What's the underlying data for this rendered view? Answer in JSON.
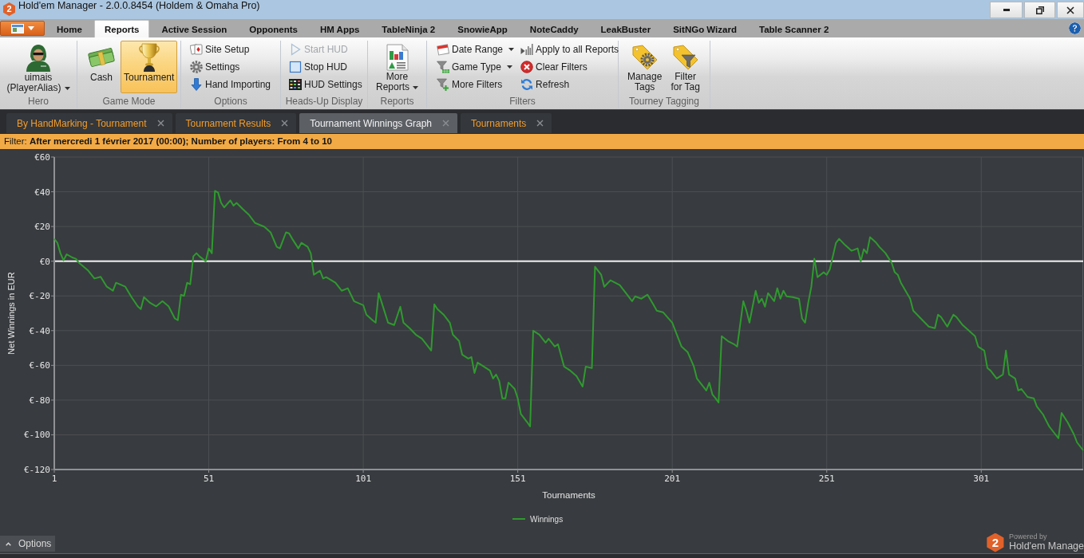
{
  "window": {
    "logo_text": "2",
    "title": "Hold'em Manager - 2.0.0.8454 (Holdem & Omaha Pro)"
  },
  "ribbon_tabs": [
    {
      "label": "Home",
      "selected": false
    },
    {
      "label": "Reports",
      "selected": true
    },
    {
      "label": "Active Session",
      "selected": false
    },
    {
      "label": "Opponents",
      "selected": false
    },
    {
      "label": "HM Apps",
      "selected": false
    },
    {
      "label": "TableNinja 2",
      "selected": false
    },
    {
      "label": "SnowieApp",
      "selected": false
    },
    {
      "label": "NoteCaddy",
      "selected": false
    },
    {
      "label": "LeakBuster",
      "selected": false
    },
    {
      "label": "SitNGo Wizard",
      "selected": false
    },
    {
      "label": "Table Scanner 2",
      "selected": false
    }
  ],
  "ribbon": {
    "hero": {
      "label": "uimais\n(PlayerAlias)",
      "dropdown": true,
      "group_label": "Hero"
    },
    "game_mode": {
      "buttons": [
        {
          "label": "Cash",
          "selected": false
        },
        {
          "label": "Tournament",
          "selected": true
        }
      ],
      "group_label": "Game Mode"
    },
    "options": {
      "items": [
        {
          "label": "Site Setup"
        },
        {
          "label": "Settings"
        },
        {
          "label": "Hand Importing"
        }
      ],
      "group_label": "Options"
    },
    "heads_up_display": {
      "items": [
        {
          "label": "Start HUD",
          "disabled": true
        },
        {
          "label": "Stop HUD",
          "disabled": false
        },
        {
          "label": "HUD Settings",
          "disabled": false
        }
      ],
      "group_label": "Heads-Up Display"
    },
    "reports": {
      "button": {
        "label": "More\nReports",
        "dropdown": true
      },
      "group_label": "Reports"
    },
    "filters": {
      "items": [
        {
          "label": "Date Range",
          "dropdown": true
        },
        {
          "label": "Game Type",
          "dropdown": true
        },
        {
          "label": "More Filters",
          "dropdown": false
        },
        {
          "label": "Apply to all Reports",
          "dropdown": false
        },
        {
          "label": "Clear Filters",
          "dropdown": false
        },
        {
          "label": "Refresh",
          "dropdown": false
        }
      ],
      "group_label": "Filters"
    },
    "tourney_tagging": {
      "buttons": [
        {
          "label": "Manage\nTags"
        },
        {
          "label": "Filter\nfor Tag"
        }
      ],
      "group_label": "Tourney Tagging"
    }
  },
  "document_tabs": [
    {
      "label": "By HandMarking - Tournament",
      "selected": false
    },
    {
      "label": "Tournament Results",
      "selected": false
    },
    {
      "label": "Tournament Winnings Graph",
      "selected": true
    },
    {
      "label": "Tournaments",
      "selected": false
    }
  ],
  "filter_bar": {
    "text": "Filter: **After mercredi 1 février 2017 (00:00); Number of players: From 4 to 10**"
  },
  "graph": {
    "chart_data": {
      "type": "line",
      "xlabel": "Tournaments",
      "ylabel": "Net Winnings in EUR",
      "xlim": [
        1,
        334
      ],
      "ylim": [
        -120,
        60
      ],
      "xticks": [
        1,
        51,
        101,
        151,
        201,
        251,
        301
      ],
      "yticks": [
        {
          "value": 60,
          "label": "€60"
        },
        {
          "value": 40,
          "label": "€40"
        },
        {
          "value": 20,
          "label": "€20"
        },
        {
          "value": 0,
          "label": "€0"
        },
        {
          "value": -20,
          "label": "€-20"
        },
        {
          "value": -40,
          "label": "€-40"
        },
        {
          "value": -60,
          "label": "€-60"
        },
        {
          "value": -80,
          "label": "€-80"
        },
        {
          "value": -100,
          "label": "€-100"
        },
        {
          "value": -120,
          "label": "€-120"
        }
      ],
      "x": [
        1,
        2,
        3,
        4,
        5,
        7,
        8,
        9,
        12,
        14,
        16,
        18,
        20,
        21,
        24,
        26,
        28,
        29,
        30,
        32,
        34,
        36,
        38,
        40,
        41,
        42,
        43,
        44,
        45,
        46,
        47,
        48,
        50,
        51,
        52,
        53,
        54,
        55,
        56,
        58,
        59,
        60,
        62,
        64,
        66,
        69,
        71,
        73,
        74,
        76,
        77,
        78,
        80,
        81,
        83,
        84,
        85,
        87,
        88,
        89,
        92,
        94,
        96,
        98,
        101,
        102,
        104,
        105,
        106,
        107,
        109,
        111,
        113,
        114,
        116,
        118,
        120,
        122,
        123,
        124,
        125,
        127,
        129,
        130,
        132,
        133,
        135,
        136,
        137,
        138,
        140,
        142,
        143,
        144,
        145,
        146,
        147,
        148,
        150,
        151,
        152,
        154,
        155,
        156,
        158,
        160,
        161,
        163,
        164,
        166,
        168,
        170,
        172,
        173,
        175,
        176,
        178,
        179,
        181,
        184,
        186,
        188,
        189,
        191,
        193,
        195,
        196,
        198,
        201,
        203,
        204,
        206,
        208,
        209,
        211,
        212,
        213,
        214,
        215,
        216,
        217,
        219,
        221,
        222,
        224,
        225,
        226,
        228,
        229,
        230,
        231,
        232,
        234,
        235,
        236,
        237,
        238,
        240,
        242,
        243,
        244,
        245,
        246,
        247,
        248,
        250,
        251,
        252,
        254,
        255,
        257,
        259,
        261,
        262,
        263,
        264,
        265,
        267,
        268,
        270,
        272,
        273,
        274,
        275,
        278,
        279,
        282,
        284,
        286,
        287,
        288,
        290,
        292,
        293,
        295,
        297,
        299,
        300,
        302,
        303,
        304,
        306,
        308,
        309,
        310,
        312,
        313,
        314,
        316,
        318,
        319,
        321,
        323,
        325,
        326,
        327,
        329,
        331,
        332,
        334
      ],
      "series": [
        {
          "name": "Winnings",
          "color": "#2f9a2f",
          "values": [
            12.9,
            10.6,
            4.6,
            0.5,
            4,
            2,
            1.4,
            -1,
            -5.5,
            -10,
            -9,
            -14.7,
            -17,
            -12.4,
            -14.7,
            -20.7,
            -26,
            -27.6,
            -20.7,
            -24,
            -26,
            -23,
            -26,
            -33,
            -34,
            -19.3,
            -20,
            -12.4,
            -13.3,
            2.8,
            4.6,
            2.8,
            0,
            7.4,
            4.6,
            40.5,
            39.5,
            33.6,
            31,
            35,
            32,
            33.6,
            30,
            26.7,
            22,
            19.8,
            16.6,
            8.3,
            7.4,
            16.6,
            16,
            12.9,
            7.4,
            10.6,
            8.3,
            4.6,
            -7.8,
            -5.5,
            -10,
            -9.2,
            -12.4,
            -17,
            -15.6,
            -23,
            -25.3,
            -30.8,
            -34,
            -35.4,
            -18.4,
            -24,
            -35.4,
            -36.8,
            -26.2,
            -35.4,
            -38.6,
            -42.3,
            -44.6,
            -49.2,
            -51.5,
            -24.8,
            -27.6,
            -30.8,
            -35.4,
            -42.3,
            -46,
            -53.8,
            -56.1,
            -55.2,
            -64.4,
            -58.4,
            -60.7,
            -63,
            -67.6,
            -65.3,
            -69,
            -79,
            -79,
            -69.9,
            -73.6,
            -79,
            -88,
            -92.6,
            -95.2,
            -40,
            -42.3,
            -46.9,
            -44.6,
            -49.2,
            -47.8,
            -60.7,
            -63,
            -66.2,
            -72.2,
            -60.7,
            -61.6,
            -3.2,
            -7.8,
            -14.7,
            -11,
            -13.8,
            -18.4,
            -23,
            -20.2,
            -21.6,
            -19.3,
            -25.3,
            -28.5,
            -29.4,
            -35.4,
            -44.6,
            -49.2,
            -52.4,
            -60.7,
            -67.6,
            -72.2,
            -74.5,
            -70,
            -76.8,
            -79,
            -81.4,
            -43.2,
            -46,
            -47.8,
            -49.2,
            -23,
            -28.5,
            -35.4,
            -17,
            -24,
            -21.6,
            -26.2,
            -18.4,
            -23,
            -15.6,
            -21.6,
            -17,
            -20.2,
            -20.7,
            -21.6,
            -33,
            -35.4,
            -24,
            -14.7,
            1.4,
            -9.2,
            -6.4,
            -7.8,
            -4.6,
            10.6,
            12.9,
            9.2,
            6,
            7.4,
            0,
            6.9,
            4.6,
            13.8,
            10.6,
            8.3,
            4.6,
            -0.9,
            -6.4,
            -7.8,
            -12.4,
            -21.6,
            -28.5,
            -34,
            -37.7,
            -38.6,
            -30.8,
            -32.2,
            -37.7,
            -30.8,
            -32.2,
            -36.8,
            -40,
            -43.2,
            -49.2,
            -51.5,
            -61.6,
            -63,
            -67.6,
            -65.3,
            -51.5,
            -65.3,
            -67.6,
            -74.5,
            -73.6,
            -78.2,
            -79,
            -83.7,
            -88.3,
            -95.2,
            -99.8,
            -102,
            -87.4,
            -92.9,
            -99.8,
            -104.4,
            -109
          ]
        }
      ]
    }
  },
  "options_button": {
    "label": "Options"
  },
  "powered_by": {
    "logo_text": "2",
    "caption": "Powered by",
    "name": "Hold'em Manage"
  }
}
